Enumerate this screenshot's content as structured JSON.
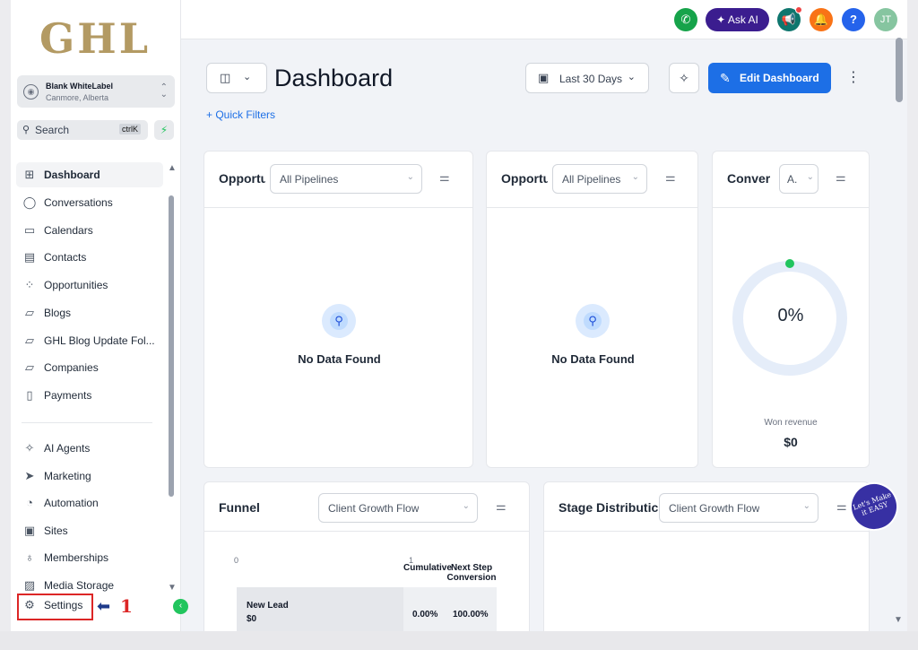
{
  "sidebar": {
    "logo": "GHL",
    "account": {
      "name": "Blank WhiteLabel",
      "location": "Canmore, Alberta"
    },
    "search": {
      "placeholder": "Search",
      "shortcut": "ctrlK"
    },
    "items": [
      {
        "label": "Dashboard",
        "icon": "grid-icon",
        "glyph": "⊞"
      },
      {
        "label": "Conversations",
        "icon": "chat-icon",
        "glyph": "◯"
      },
      {
        "label": "Calendars",
        "icon": "calendar-icon",
        "glyph": "▭"
      },
      {
        "label": "Contacts",
        "icon": "contacts-icon",
        "glyph": "▤"
      },
      {
        "label": "Opportunities",
        "icon": "opportunities-icon",
        "glyph": "⁘"
      },
      {
        "label": "Blogs",
        "icon": "cube-icon",
        "glyph": "▱"
      },
      {
        "label": "GHL Blog Update Fol...",
        "icon": "cube-icon",
        "glyph": "▱"
      },
      {
        "label": "Companies",
        "icon": "cube-icon",
        "glyph": "▱"
      },
      {
        "label": "Payments",
        "icon": "receipt-icon",
        "glyph": "▯"
      },
      {
        "label": "AI Agents",
        "icon": "sparkle-icon",
        "glyph": "✧"
      },
      {
        "label": "Marketing",
        "icon": "send-icon",
        "glyph": "➤"
      },
      {
        "label": "Automation",
        "icon": "automation-icon",
        "glyph": "◔"
      },
      {
        "label": "Sites",
        "icon": "sites-icon",
        "glyph": "▣"
      },
      {
        "label": "Memberships",
        "icon": "medal-icon",
        "glyph": "♁"
      },
      {
        "label": "Media Storage",
        "icon": "image-icon",
        "glyph": "▨"
      },
      {
        "label": "Settings",
        "icon": "gear-icon",
        "glyph": "⚙"
      }
    ],
    "annotation_number": "1"
  },
  "topbar": {
    "ask_ai": "Ask AI",
    "avatar_initials": "JT",
    "help": "?"
  },
  "header": {
    "title": "Dashboard",
    "date_range": "Last 30 Days",
    "edit_label": "Edit Dashboard",
    "quick_filters": "+ Quick Filters"
  },
  "cards": {
    "opp1": {
      "title": "Opportu",
      "select": "All Pipelines",
      "empty": "No Data Found"
    },
    "opp2": {
      "title": "Opportu",
      "select": "All Pipelines",
      "empty": "No Data Found"
    },
    "conv": {
      "title": "Conver",
      "select": "A.",
      "percent": "0%",
      "won_label": "Won revenue",
      "won_value": "$0"
    },
    "funnel": {
      "title": "Funnel",
      "select": "Client Growth Flow",
      "axis_min": "0",
      "axis_max": "1",
      "col_cumulative": "Cumulative",
      "col_next": "Next Step Conversion",
      "stage": "New Lead",
      "amount": "$0",
      "cumulative": "0.00%",
      "next": "100.00%"
    },
    "stage": {
      "title": "Stage Distributic",
      "select": "Client Growth Flow"
    }
  },
  "badge": "Let's Make it EASY",
  "colors": {
    "primary": "#1d6fe6",
    "ask_ai": "#3b1d8f",
    "phone": "#16a34a",
    "bell": "#f97316",
    "help": "#2563eb",
    "avatar": "#86c5a0",
    "logo": "#b39a63",
    "annotation": "#dc2626"
  }
}
